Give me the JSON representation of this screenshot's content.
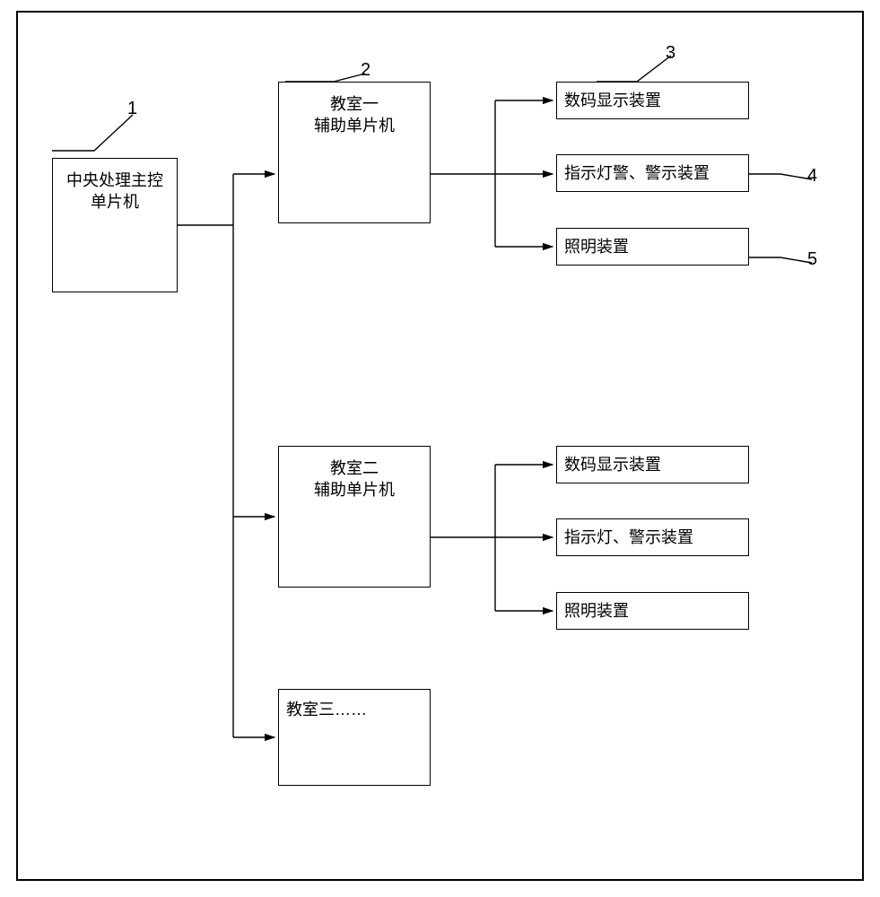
{
  "labels": {
    "n1": "1",
    "n2": "2",
    "n3": "3",
    "n4": "4",
    "n5": "5"
  },
  "boxes": {
    "central_mcu": "中央处理主控\n单片机",
    "room1_mcu": "教室一\n辅助单片机",
    "room1_display": "数码显示装置",
    "room1_alarm": "指示灯警、警示装置",
    "room1_light": "照明装置",
    "room2_mcu": "教室二\n辅助单片机",
    "room2_display": "数码显示装置",
    "room2_alarm": "指示灯、警示装置",
    "room2_light": "照明装置",
    "room3": "教室三……"
  }
}
